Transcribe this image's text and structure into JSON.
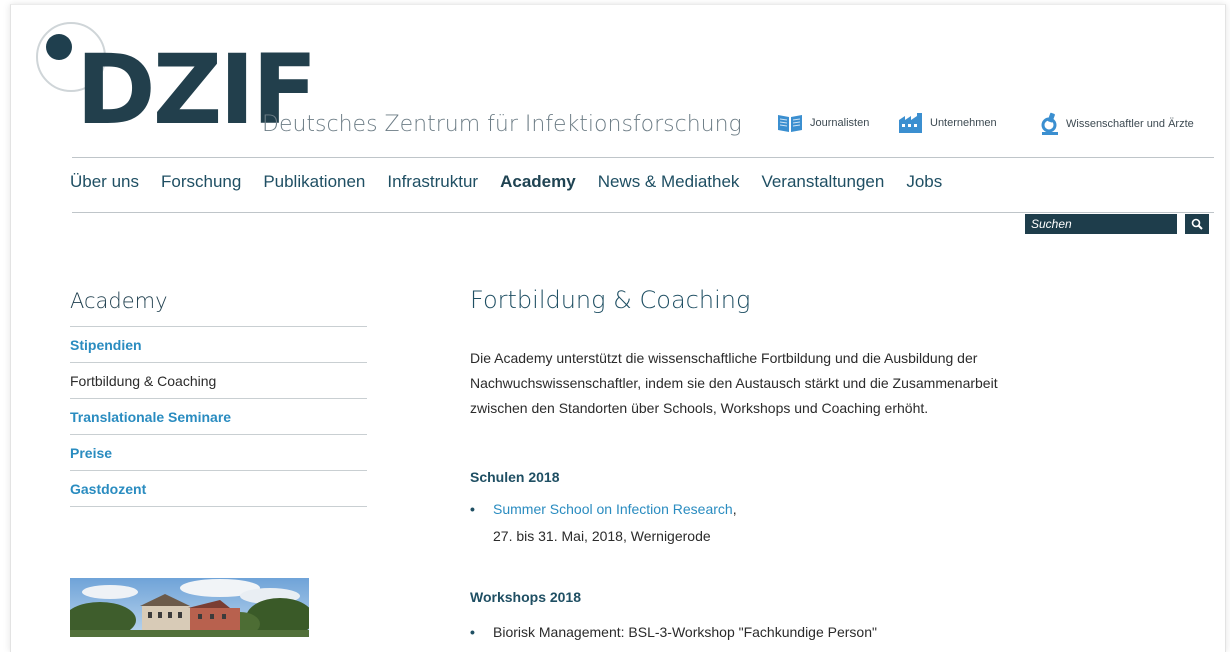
{
  "brand": {
    "logo_text": "DZIF",
    "tagline": "Deutsches Zentrum für Infektionsforschung"
  },
  "service_links": [
    {
      "label": "Journalisten",
      "icon": "book-icon"
    },
    {
      "label": "Unternehmen",
      "icon": "factory-icon"
    },
    {
      "label": "Wissenschaftler und Ärzte",
      "icon": "microscope-icon"
    }
  ],
  "nav": [
    {
      "label": "Über uns",
      "active": false
    },
    {
      "label": "Forschung",
      "active": false
    },
    {
      "label": "Publikationen",
      "active": false
    },
    {
      "label": "Infrastruktur",
      "active": false
    },
    {
      "label": "Academy",
      "active": true
    },
    {
      "label": "News & Mediathek",
      "active": false
    },
    {
      "label": "Veranstaltungen",
      "active": false
    },
    {
      "label": "Jobs",
      "active": false
    }
  ],
  "search": {
    "placeholder": "Suchen",
    "button_icon": "search-icon"
  },
  "sidebar": {
    "title": "Academy",
    "items": [
      {
        "label": "Stipendien",
        "current": false
      },
      {
        "label": "Fortbildung & Coaching",
        "current": true
      },
      {
        "label": "Translationale Seminare",
        "current": false
      },
      {
        "label": "Preise",
        "current": false
      },
      {
        "label": "Gastdozent",
        "current": false
      }
    ]
  },
  "main": {
    "title": "Fortbildung & Coaching",
    "intro_lines": [
      "Die Academy unterstützt die wissenschaftliche Fortbildung und die Ausbildung der",
      "Nachwuchswissenschaftler, indem sie den Austausch stärkt und die Zusammenarbeit",
      "zwischen den Standorten über Schools, Workshops und Coaching erhöht."
    ],
    "schulen": {
      "heading": "Schulen 2018",
      "item_link": "Summer School on Infection Research",
      "item_suffix": ",",
      "item_detail": "27. bis 31. Mai, 2018, Wernigerode"
    },
    "workshops": {
      "heading": "Workshops 2018",
      "item": "Biorisk Management: BSL-3-Workshop \"Fachkundige Person\""
    }
  },
  "colors": {
    "brand_dark": "#1f3f4e",
    "link_blue": "#2a8cc0",
    "nav_text": "#1f4f63"
  }
}
